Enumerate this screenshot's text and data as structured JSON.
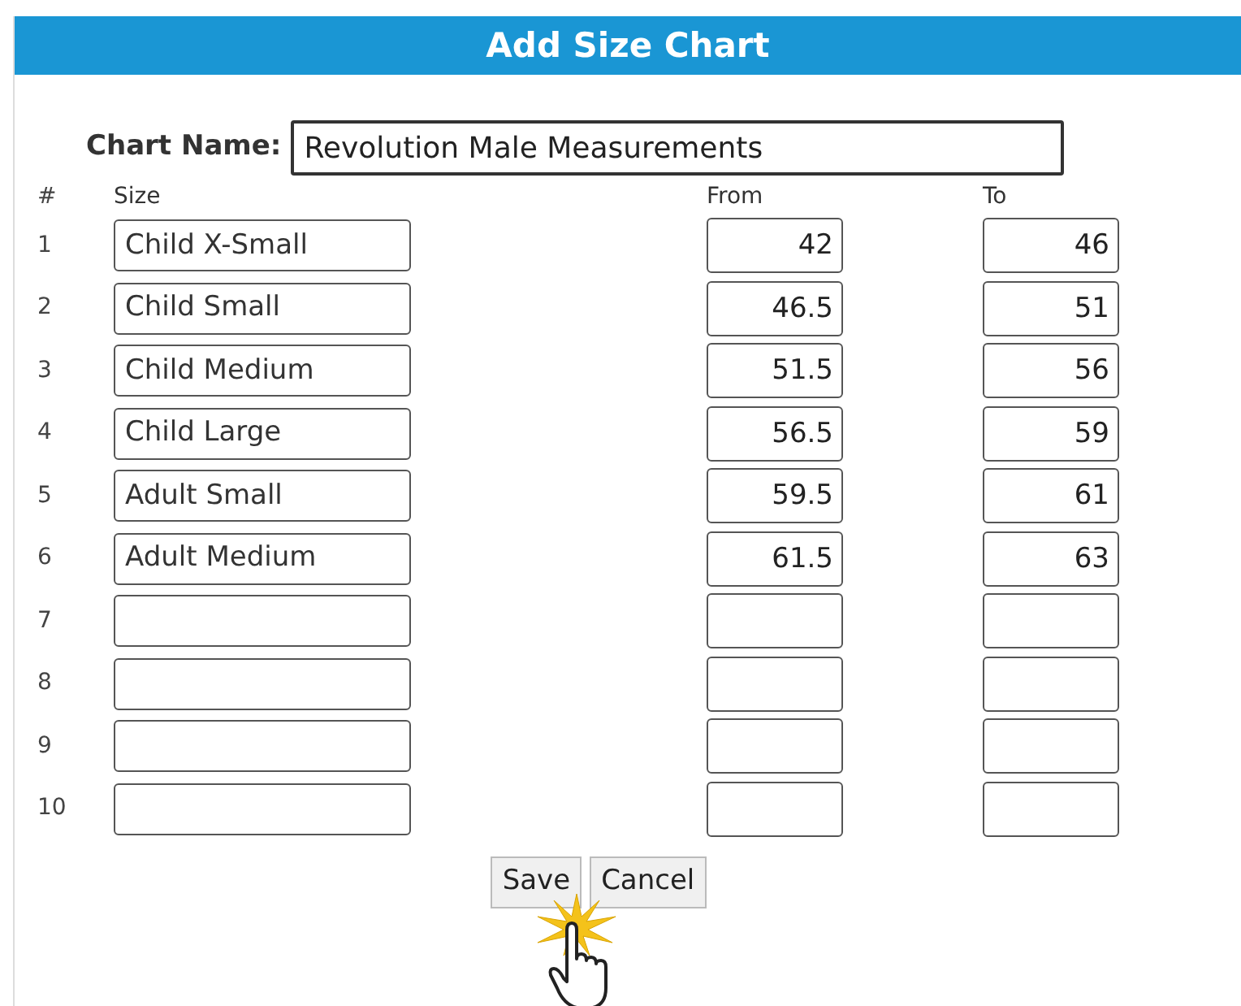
{
  "dialog": {
    "title": "Add Size Chart"
  },
  "chart_name": {
    "label": "Chart Name:",
    "value": "Revolution Male Measurements"
  },
  "columns": [
    "#",
    "Size",
    "From",
    "To"
  ],
  "rows": [
    {
      "number": "1",
      "size": "Child X-Small",
      "from": "42",
      "to": "46"
    },
    {
      "number": "2",
      "size": "Child Small",
      "from": "46.5",
      "to": "51"
    },
    {
      "number": "3",
      "size": "Child Medium",
      "from": "51.5",
      "to": "56"
    },
    {
      "number": "4",
      "size": "Child Large",
      "from": "56.5",
      "to": "59"
    },
    {
      "number": "5",
      "size": "Adult Small",
      "from": "59.5",
      "to": "61"
    },
    {
      "number": "6",
      "size": "Adult Medium",
      "from": "61.5",
      "to": "63"
    },
    {
      "number": "7"
    },
    {
      "number": "8"
    },
    {
      "number": "9"
    },
    {
      "number": "10"
    }
  ],
  "buttons": [
    "Save",
    "Cancel"
  ]
}
